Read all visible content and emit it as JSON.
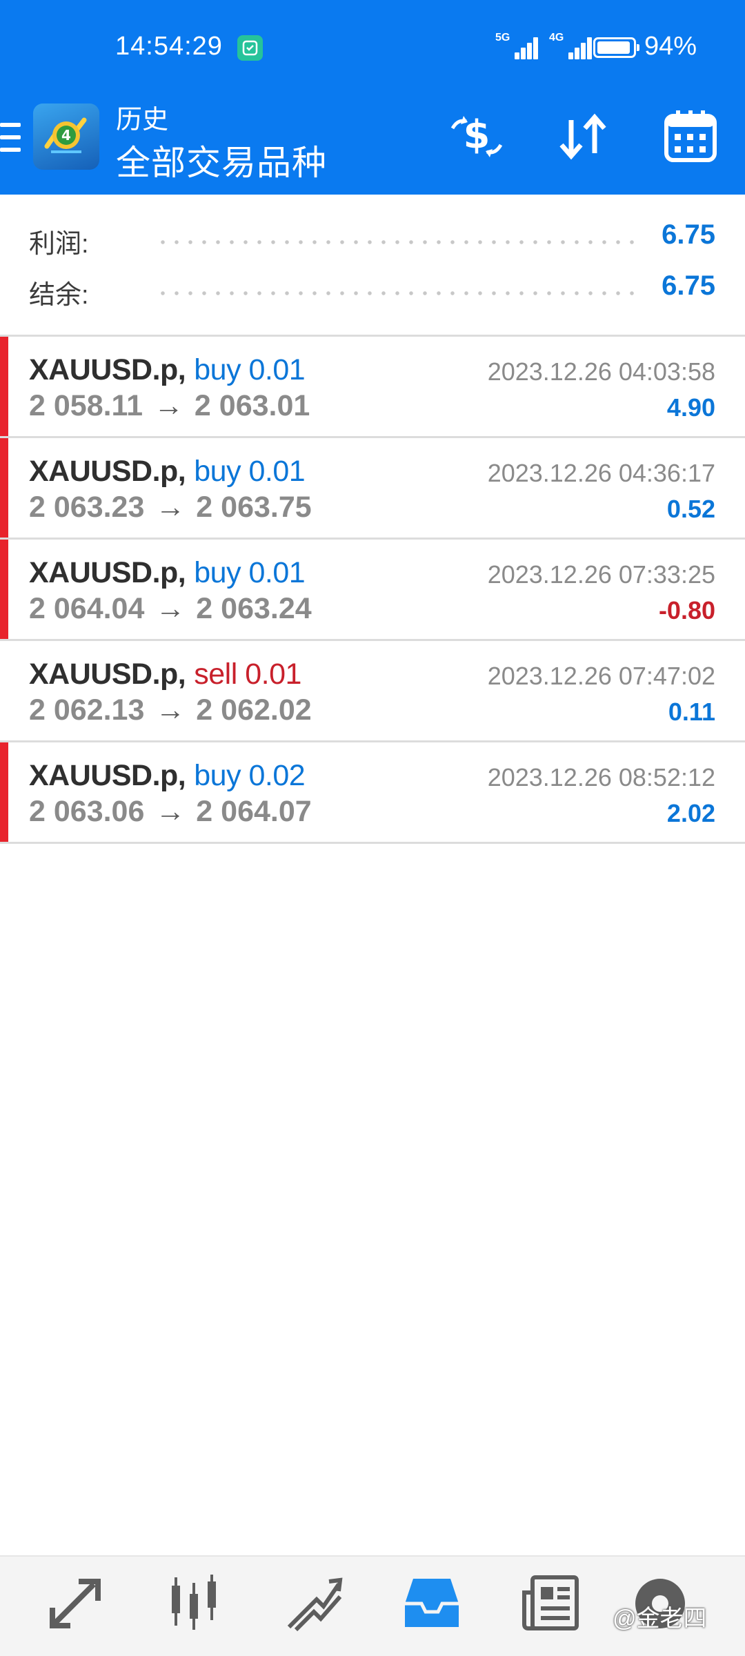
{
  "status_bar": {
    "time": "14:54:29",
    "network_1": "5G",
    "network_2": "4G",
    "battery_percent_text": "94%",
    "battery_level": 0.94
  },
  "header": {
    "title_small": "历史",
    "title_large": "全部交易品种",
    "icons": [
      "menu-icon",
      "app-logo",
      "trade-currency-icon",
      "sort-icon",
      "calendar-icon"
    ]
  },
  "summary": {
    "profit_label": "利润:",
    "profit_value": "6.75",
    "balance_label": "结余:",
    "balance_value": "6.75"
  },
  "deals": [
    {
      "symbol": "XAUUSD.p,",
      "direction": "buy 0.01",
      "open": "2 058.11",
      "close": "2 063.01",
      "time": "2023.12.26 04:03:58",
      "profit": "4.90",
      "marked": true
    },
    {
      "symbol": "XAUUSD.p,",
      "direction": "buy 0.01",
      "open": "2 063.23",
      "close": "2 063.75",
      "time": "2023.12.26 04:36:17",
      "profit": "0.52",
      "marked": true
    },
    {
      "symbol": "XAUUSD.p,",
      "direction": "buy 0.01",
      "open": "2 064.04",
      "close": "2 063.24",
      "time": "2023.12.26 07:33:25",
      "profit": "-0.80",
      "marked": true
    },
    {
      "symbol": "XAUUSD.p,",
      "direction": "sell 0.01",
      "open": "2 062.13",
      "close": "2 062.02",
      "time": "2023.12.26 07:47:02",
      "profit": "0.11",
      "marked": false
    },
    {
      "symbol": "XAUUSD.p,",
      "direction": "buy 0.02",
      "open": "2 063.06",
      "close": "2 064.07",
      "time": "2023.12.26 08:52:12",
      "profit": "2.02",
      "marked": true
    }
  ],
  "arrow": "→",
  "bottom_nav": {
    "items": [
      "quotes-icon",
      "chart-icon",
      "trade-icon",
      "history-icon",
      "news-icon",
      "settings-icon"
    ],
    "active": "history-icon"
  },
  "watermark": "@金老四",
  "colors": {
    "header_bg": "#0a7af0",
    "positive": "#0b76d8",
    "negative": "#c8202b",
    "marker": "#e8232c",
    "active_nav": "#1e8ef0"
  }
}
